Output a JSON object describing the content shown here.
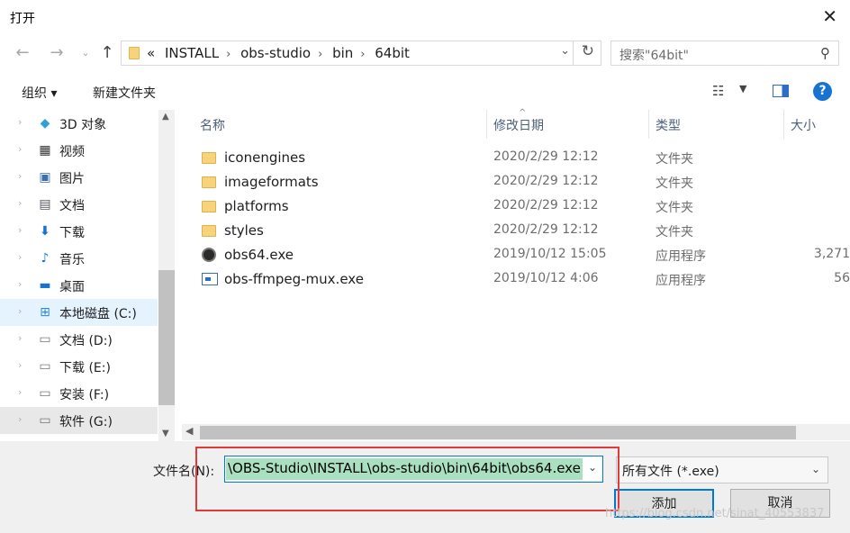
{
  "window": {
    "title": "打开"
  },
  "nav": {
    "crumbs": [
      "INSTALL",
      "obs-studio",
      "bin",
      "64bit"
    ],
    "overflow": "«",
    "search_placeholder": "搜索\"64bit\""
  },
  "toolbar": {
    "organize": "组织 ▾",
    "new_folder": "新建文件夹"
  },
  "tree": [
    {
      "label": "3D 对象",
      "icon": "cube-icon"
    },
    {
      "label": "视频",
      "icon": "video-icon"
    },
    {
      "label": "图片",
      "icon": "picture-icon"
    },
    {
      "label": "文档",
      "icon": "document-icon"
    },
    {
      "label": "下载",
      "icon": "download-icon"
    },
    {
      "label": "音乐",
      "icon": "music-icon"
    },
    {
      "label": "桌面",
      "icon": "desktop-icon"
    },
    {
      "label": "本地磁盘 (C:)",
      "icon": "system-drive-icon"
    },
    {
      "label": "文档 (D:)",
      "icon": "drive-icon"
    },
    {
      "label": "下载 (E:)",
      "icon": "drive-icon"
    },
    {
      "label": "安装 (F:)",
      "icon": "drive-icon"
    },
    {
      "label": "软件 (G:)",
      "icon": "drive-icon"
    }
  ],
  "columns": {
    "name": "名称",
    "modified": "修改日期",
    "type": "类型",
    "size": "大小"
  },
  "files": [
    {
      "name": "iconengines",
      "modified": "2020/2/29 12:12",
      "type": "文件夹",
      "size": "",
      "icon": "folder-icon"
    },
    {
      "name": "imageformats",
      "modified": "2020/2/29 12:12",
      "type": "文件夹",
      "size": "",
      "icon": "folder-icon"
    },
    {
      "name": "platforms",
      "modified": "2020/2/29 12:12",
      "type": "文件夹",
      "size": "",
      "icon": "folder-icon"
    },
    {
      "name": "styles",
      "modified": "2020/2/29 12:12",
      "type": "文件夹",
      "size": "",
      "icon": "folder-icon"
    },
    {
      "name": "obs64.exe",
      "modified": "2019/10/12 15:05",
      "type": "应用程序",
      "size": "3,271",
      "icon": "obs-app-icon"
    },
    {
      "name": "obs-ffmpeg-mux.exe",
      "modified": "2019/10/12 4:06",
      "type": "应用程序",
      "size": "56",
      "icon": "application-icon"
    }
  ],
  "footer": {
    "filename_label": "文件名(N):",
    "filename_value": "\\OBS-Studio\\INSTALL\\obs-studio\\bin\\64bit\\obs64.exe",
    "filetype": "所有文件 (*.exe)",
    "open_button": "添加",
    "cancel_button": "取消",
    "watermark": "https://blog.csdn.net/sinat_40553837"
  },
  "colors": {
    "accent": "#0078d7",
    "highlight": "#e23a3a",
    "selection": "#a8e0c0"
  }
}
